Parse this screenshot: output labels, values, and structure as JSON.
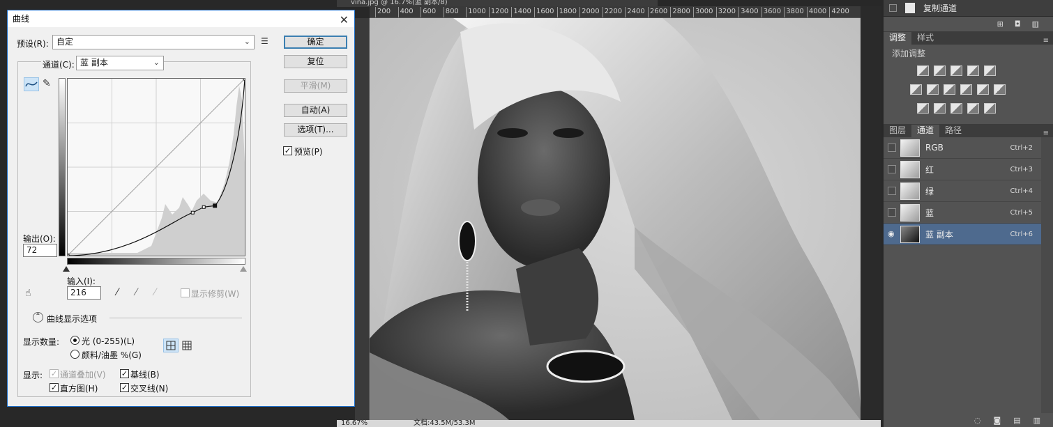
{
  "document": {
    "tab_title": "vina.jpg @ 16.7%(蓝 副本/8)",
    "ruler_ticks": [
      "200",
      "400",
      "600",
      "800",
      "1000",
      "1200",
      "1400",
      "1600",
      "1800",
      "2000",
      "2200",
      "2400",
      "2600",
      "2800",
      "3000",
      "3200",
      "3400",
      "3600",
      "3800",
      "4000",
      "4200"
    ],
    "status_zoom": "16.67%",
    "status_doc": "文档:43.5M/53.3M"
  },
  "dialog": {
    "title": "曲线",
    "preset_label": "预设(R):",
    "preset_value": "自定",
    "channel_label": "通道(C):",
    "channel_value": "蓝 副本",
    "buttons": {
      "ok": "确定",
      "reset": "复位",
      "smooth": "平滑(M)",
      "auto": "自动(A)",
      "options": "选项(T)..."
    },
    "preview_label": "预览(P)",
    "preview_checked": true,
    "output_label": "输出(O):",
    "output_value": "72",
    "input_label": "输入(I):",
    "input_value": "216",
    "show_clipping": "显示修剪(W)",
    "display_options": "曲线显示选项",
    "show_amount_label": "显示数量:",
    "light_option": "光 (0-255)(L)",
    "pigment_option": "颜料/油墨 %(G)",
    "show_label": "显示:",
    "channel_overlay": "通道叠加(V)",
    "baseline": "基线(B)",
    "histogram": "直方图(H)",
    "intersection": "交叉线(N)",
    "curve_points": [
      [
        0,
        0
      ],
      [
        180,
        62
      ],
      [
        196,
        70
      ],
      [
        212,
        72
      ],
      [
        255,
        255
      ]
    ],
    "icons": {
      "curve_tool": "curve-point-icon",
      "pencil_tool": "pencil-icon",
      "preset_menu": "preset-options-icon",
      "hand_tool": "targeted-adjust-hand-icon",
      "eyedroppers": [
        "black-eyedropper-icon",
        "gray-eyedropper-icon",
        "white-eyedropper-icon"
      ],
      "grid_simple": "grid-4x4-icon",
      "grid_detailed": "grid-10x10-icon"
    }
  },
  "panels": {
    "copy_channel_action": "复制通道",
    "adjust_tabs": [
      "调整",
      "样式"
    ],
    "adjust_subtitle": "添加调整",
    "channel_tabs": [
      "图层",
      "通道",
      "路径"
    ],
    "channels": [
      {
        "name": "RGB",
        "shortcut": "Ctrl+2",
        "visible": false,
        "selected": false
      },
      {
        "name": "红",
        "shortcut": "Ctrl+3",
        "visible": false,
        "selected": false
      },
      {
        "name": "绿",
        "shortcut": "Ctrl+4",
        "visible": false,
        "selected": false
      },
      {
        "name": "蓝",
        "shortcut": "Ctrl+5",
        "visible": false,
        "selected": false
      },
      {
        "name": "蓝 副本",
        "shortcut": "Ctrl+6",
        "visible": true,
        "selected": true
      }
    ],
    "colors": {
      "selected_row": "#4e6a8e",
      "panel_bg": "#535353",
      "dialog_border": "#1e6ec8"
    }
  }
}
